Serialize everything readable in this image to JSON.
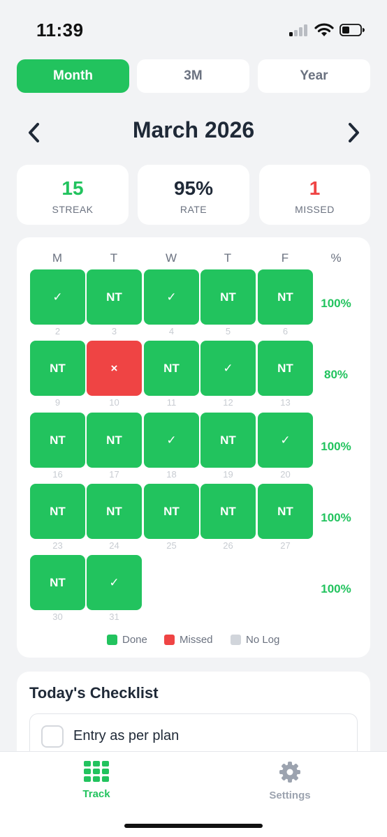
{
  "status_bar": {
    "time": "11:39"
  },
  "range_tabs": [
    {
      "label": "Month",
      "active": true
    },
    {
      "label": "3M",
      "active": false
    },
    {
      "label": "Year",
      "active": false
    }
  ],
  "month_title": "March 2026",
  "stats": [
    {
      "value": "15",
      "label": "STREAK",
      "color": "#22c35e"
    },
    {
      "value": "95%",
      "label": "RATE",
      "color": "#1f2937"
    },
    {
      "value": "1",
      "label": "MISSED",
      "color": "#ef4444"
    }
  ],
  "calendar": {
    "headers": [
      "M",
      "T",
      "W",
      "T",
      "F",
      "%"
    ],
    "weeks": [
      {
        "pct": "100%",
        "days": [
          {
            "num": "2",
            "mark": "✓",
            "status": "done"
          },
          {
            "num": "3",
            "mark": "NT",
            "status": "done"
          },
          {
            "num": "4",
            "mark": "✓",
            "status": "done"
          },
          {
            "num": "5",
            "mark": "NT",
            "status": "done"
          },
          {
            "num": "6",
            "mark": "NT",
            "status": "done"
          }
        ]
      },
      {
        "pct": "80%",
        "days": [
          {
            "num": "9",
            "mark": "NT",
            "status": "done"
          },
          {
            "num": "10",
            "mark": "×",
            "status": "missed"
          },
          {
            "num": "11",
            "mark": "NT",
            "status": "done"
          },
          {
            "num": "12",
            "mark": "✓",
            "status": "done"
          },
          {
            "num": "13",
            "mark": "NT",
            "status": "done"
          }
        ]
      },
      {
        "pct": "100%",
        "days": [
          {
            "num": "16",
            "mark": "NT",
            "status": "done"
          },
          {
            "num": "17",
            "mark": "NT",
            "status": "done"
          },
          {
            "num": "18",
            "mark": "✓",
            "status": "done"
          },
          {
            "num": "19",
            "mark": "NT",
            "status": "done"
          },
          {
            "num": "20",
            "mark": "✓",
            "status": "done"
          }
        ]
      },
      {
        "pct": "100%",
        "days": [
          {
            "num": "23",
            "mark": "NT",
            "status": "done"
          },
          {
            "num": "24",
            "mark": "NT",
            "status": "done"
          },
          {
            "num": "25",
            "mark": "NT",
            "status": "done"
          },
          {
            "num": "26",
            "mark": "NT",
            "status": "done"
          },
          {
            "num": "27",
            "mark": "NT",
            "status": "done"
          }
        ]
      },
      {
        "pct": "100%",
        "days": [
          {
            "num": "30",
            "mark": "NT",
            "status": "done"
          },
          {
            "num": "31",
            "mark": "✓",
            "status": "done"
          }
        ]
      }
    ]
  },
  "legend": [
    {
      "label": "Done",
      "color": "#22c35e"
    },
    {
      "label": "Missed",
      "color": "#ef4444"
    },
    {
      "label": "No Log",
      "color": "#d1d5db"
    }
  ],
  "checklist": {
    "title": "Today's Checklist",
    "items": [
      {
        "label": "Entry as per plan",
        "checked": false
      }
    ]
  },
  "tab_bar": [
    {
      "label": "Track",
      "icon": "grid-icon",
      "active": true,
      "color": "#22c35e"
    },
    {
      "label": "Settings",
      "icon": "gear-icon",
      "active": false,
      "color": "#9ca3af"
    }
  ]
}
